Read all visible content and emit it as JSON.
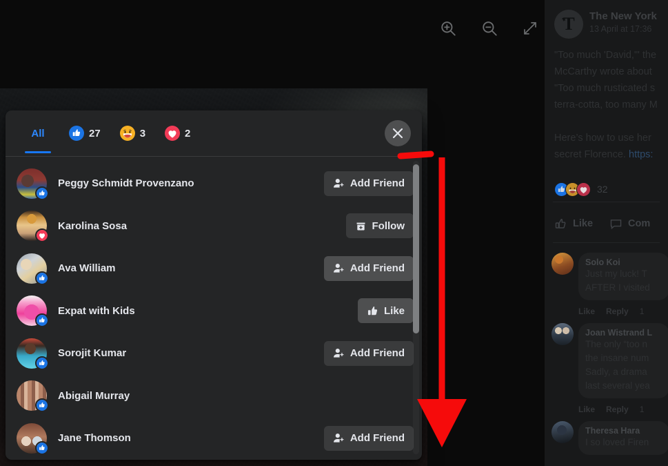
{
  "viewer": {
    "tools": [
      {
        "name": "zoom-in-icon",
        "label": "Zoom in"
      },
      {
        "name": "zoom-out-icon",
        "label": "Zoom out"
      },
      {
        "name": "expand-icon",
        "label": "Enter full screen"
      }
    ]
  },
  "modal": {
    "close_label": "✕",
    "tabs": [
      {
        "id": "all",
        "label": "All",
        "count": "",
        "emoji": null,
        "active": true
      },
      {
        "id": "like",
        "label": "",
        "count": "27",
        "emoji": "like",
        "active": false
      },
      {
        "id": "haha",
        "label": "",
        "count": "3",
        "emoji": "haha",
        "active": false
      },
      {
        "id": "love",
        "label": "",
        "count": "2",
        "emoji": "love",
        "active": false
      }
    ],
    "rows": [
      {
        "name": "Peggy Schmidt Provenzano",
        "action": "Add Friend",
        "action_icon": "add-friend-icon",
        "badge": "like",
        "hover": false
      },
      {
        "name": "Karolina Sosa",
        "action": "Follow",
        "action_icon": "follow-icon",
        "badge": "love",
        "hover": false
      },
      {
        "name": "Ava William",
        "action": "Add Friend",
        "action_icon": "add-friend-icon",
        "badge": "like",
        "hover": true
      },
      {
        "name": "Expat with Kids",
        "action": "Like",
        "action_icon": "thumbs-up-icon",
        "badge": "like",
        "hover": true
      },
      {
        "name": "Sorojit Kumar",
        "action": "Add Friend",
        "action_icon": "add-friend-icon",
        "badge": "like",
        "hover": false
      },
      {
        "name": "Abigail Murray",
        "action": "",
        "action_icon": "",
        "badge": "like",
        "hover": false
      },
      {
        "name": "Jane Thomson",
        "action": "Add Friend",
        "action_icon": "add-friend-icon",
        "badge": "like",
        "hover": false
      }
    ]
  },
  "feed": {
    "page_name": "The New York",
    "timestamp": "13 April at 17:36",
    "post_lines_1": [
      "\"Too much 'David,'\" the",
      "McCarthy wrote about",
      "\"Too much rusticated s",
      "terra-cotta, too many M"
    ],
    "post_lines_2": [
      "Here’s how to use her",
      "secret Florence."
    ],
    "post_link": "https:",
    "reaction_count": "32",
    "reaction_emojis": [
      "like",
      "haha",
      "love"
    ],
    "actions": [
      {
        "name": "like-button",
        "label": "Like",
        "icon": "thumbs-up-outline-icon"
      },
      {
        "name": "comment-button",
        "label": "Com",
        "icon": "comment-bubble-icon"
      }
    ],
    "comments": [
      {
        "name": "Solo Koi",
        "lines": [
          "Just my luck! T",
          "AFTER I visited"
        ],
        "meta": {
          "like": "Like",
          "reply": "Reply",
          "time": "1"
        }
      },
      {
        "name": "Joan Wistrand L",
        "lines": [
          "The only “too n",
          "the insane num",
          "Sadly, a drama",
          "last several yea"
        ],
        "meta": {
          "like": "Like",
          "reply": "Reply",
          "time": "1"
        }
      },
      {
        "name": "Theresa Hara",
        "lines": [
          "I so loved Firen"
        ],
        "meta": null
      }
    ]
  },
  "annotation": {
    "type": "red-arrow-down",
    "color": "#f60b0b",
    "description": "Red vertical arrow pointing down alongside the dialog scrollbar, with a short red horizontal stroke near the top"
  },
  "colors": {
    "modal_bg": "#242526",
    "button_bg": "#3a3b3c",
    "button_hover_bg": "#4e4f50",
    "accent_blue": "#1877f2",
    "tab_active_text": "#2d88ff",
    "text_primary": "#e4e6eb",
    "text_secondary": "#b0b3b8",
    "feed_bg": "#18191a",
    "annotation_red": "#f60b0b"
  }
}
